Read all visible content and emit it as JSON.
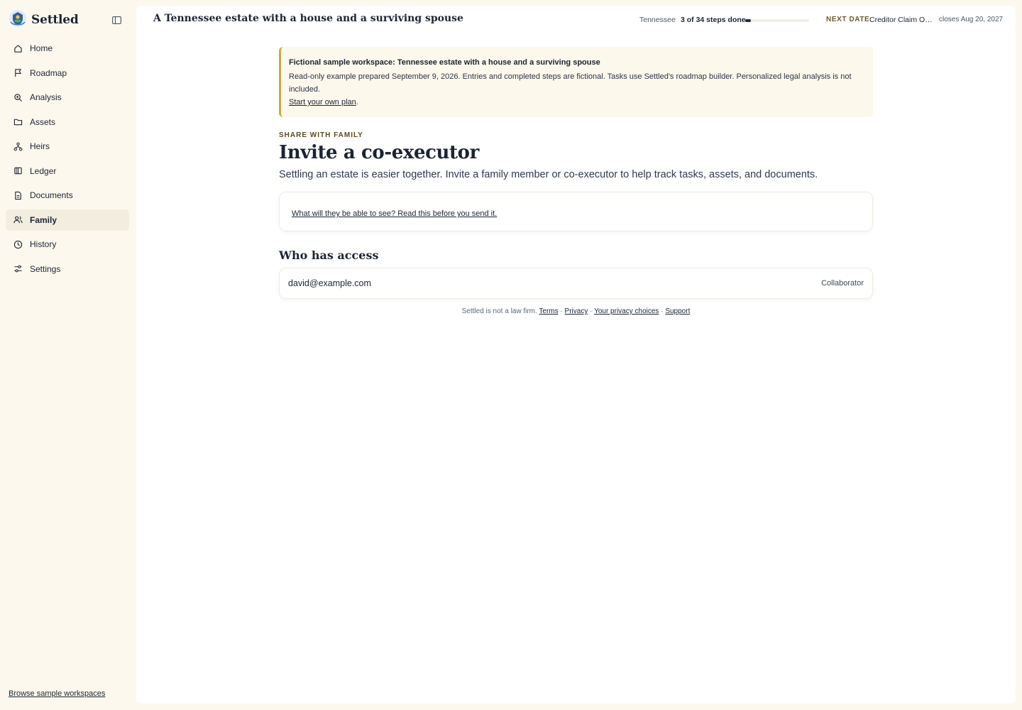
{
  "brand": {
    "name": "Settled"
  },
  "sidebar": {
    "items": [
      {
        "label": "Home",
        "icon": "home-icon"
      },
      {
        "label": "Roadmap",
        "icon": "flag-icon"
      },
      {
        "label": "Analysis",
        "icon": "zoom-search-icon"
      },
      {
        "label": "Assets",
        "icon": "folder-icon"
      },
      {
        "label": "Heirs",
        "icon": "family-tree-icon"
      },
      {
        "label": "Ledger",
        "icon": "columns-icon"
      },
      {
        "label": "Documents",
        "icon": "document-icon"
      },
      {
        "label": "Family",
        "icon": "users-icon",
        "active": true
      },
      {
        "label": "History",
        "icon": "clock-icon"
      },
      {
        "label": "Settings",
        "icon": "sliders-icon"
      }
    ],
    "browse_link": "Browse sample workspaces"
  },
  "header": {
    "estate_title": "A Tennessee estate with a house and a surviving spouse",
    "state": "Tennessee",
    "steps": "3 of 34 steps done",
    "progress_fraction": 0.088,
    "next_date_label": "NEXT DATE",
    "next_date_task": "Creditor Claim Out...",
    "next_date_close": "closes Aug 20, 2027"
  },
  "notice": {
    "title": "Fictional sample workspace: Tennessee estate with a house and a surviving spouse",
    "body": "Read-only example prepared September 9, 2026. Entries and completed steps are fictional. Tasks use Settled's roadmap builder. Personalized legal analysis is not included.",
    "link": "Start your own plan",
    "link_suffix": "."
  },
  "page": {
    "eyebrow": "SHARE WITH FAMILY",
    "title": "Invite a co-executor",
    "subtitle": "Settling an estate is easier together. Invite a family member or co-executor to help track tasks, assets, and documents.",
    "info_link": "What will they be able to see? Read this before you send it."
  },
  "access": {
    "title": "Who has access",
    "rows": [
      {
        "email": "david@example.com",
        "role": "Collaborator"
      }
    ]
  },
  "footer": {
    "prefix": "Settled is not a law firm.",
    "terms": "Terms",
    "privacy": "Privacy",
    "privacy_choices": "Your privacy choices",
    "support": "Support",
    "separator": "·"
  },
  "colors": {
    "background": "#fcf8ee",
    "accent_gold": "#c9a74a",
    "ink": "#1c2433",
    "progress": "#1e2b45"
  }
}
